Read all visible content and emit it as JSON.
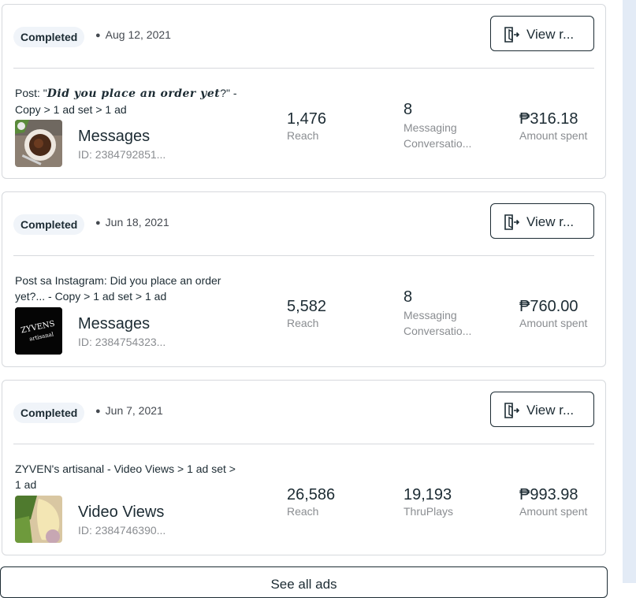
{
  "campaigns": [
    {
      "status": "Completed",
      "date": "Aug 12, 2021",
      "view_label": "View r...",
      "title_prefix": "Post: \"",
      "title_quote": "Did you place an order yet",
      "title_suffix": "?\" - Copy > 1 ad set > 1 ad",
      "ad_name": "Messages",
      "ad_id": "ID: 2384792851...",
      "reach_value": "1,476",
      "reach_label": "Reach",
      "result_value": "8",
      "result_label": "Messaging Conversatio...",
      "spent_value": "₱316.18",
      "spent_label": "Amount spent",
      "thumb_icon": "coffee-cup-thumbnail"
    },
    {
      "status": "Completed",
      "date": "Jun 18, 2021",
      "view_label": "View r...",
      "title": "Post sa Instagram: Did you place an order yet?... - Copy > 1 ad set > 1 ad",
      "ad_name": "Messages",
      "ad_id": "ID: 2384754323...",
      "reach_value": "5,582",
      "reach_label": "Reach",
      "result_value": "8",
      "result_label": "Messaging Conversatio...",
      "spent_value": "₱760.00",
      "spent_label": "Amount spent",
      "thumb_text_1": "ZYVENS",
      "thumb_text_2": "artisanal"
    },
    {
      "status": "Completed",
      "date": "Jun 7, 2021",
      "view_label": "View r...",
      "title": "ZYVEN's artisanal - Video Views > 1 ad set > 1 ad",
      "ad_name": "Video Views",
      "ad_id": "ID: 2384746390...",
      "reach_value": "26,586",
      "reach_label": "Reach",
      "result_value": "19,193",
      "result_label": "ThruPlays",
      "spent_value": "₱993.98",
      "spent_label": "Amount spent",
      "thumb_icon": "food-plate-thumbnail"
    }
  ],
  "see_all_label": "See all ads",
  "colors": {
    "pill_bg": "#f0f4f9",
    "text_dark": "#1c2b33",
    "text_muted": "#8a8d91",
    "border": "#d6d9dd",
    "rail": "#e3ebf6"
  }
}
